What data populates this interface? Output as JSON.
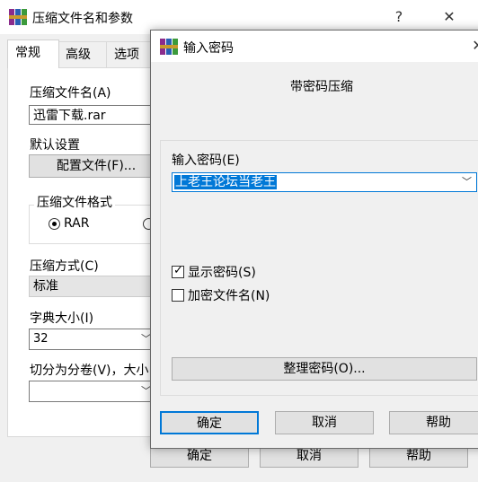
{
  "back_window": {
    "title": "压缩文件名和参数",
    "help_glyph": "?",
    "close_glyph": "✕",
    "tabs": [
      "常规",
      "高级",
      "选项"
    ],
    "archive_name_label": "压缩文件名(A)",
    "archive_name_value": "迅雷下载.rar",
    "default_settings_label": "默认设置",
    "profiles_button": "配置文件(F)...",
    "format_group_label": "压缩文件格式",
    "format_rar": "RAR",
    "method_label": "压缩方式(C)",
    "method_value": "标准",
    "dict_label": "字典大小(I)",
    "dict_value": "32",
    "split_label": "切分为分卷(V)，大小",
    "ok": "确定",
    "cancel": "取消",
    "help": "帮助"
  },
  "dialog": {
    "title": "输入密码",
    "close_glyph": "✕",
    "header": "带密码压缩",
    "password_label": "输入密码(E)",
    "password_value": "上老王论坛当老王",
    "show_password": "显示密码(S)",
    "show_password_checked": true,
    "encrypt_names": "加密文件名(N)",
    "encrypt_names_checked": false,
    "organize_button": "整理密码(O)...",
    "ok": "确定",
    "cancel": "取消",
    "help": "帮助"
  }
}
